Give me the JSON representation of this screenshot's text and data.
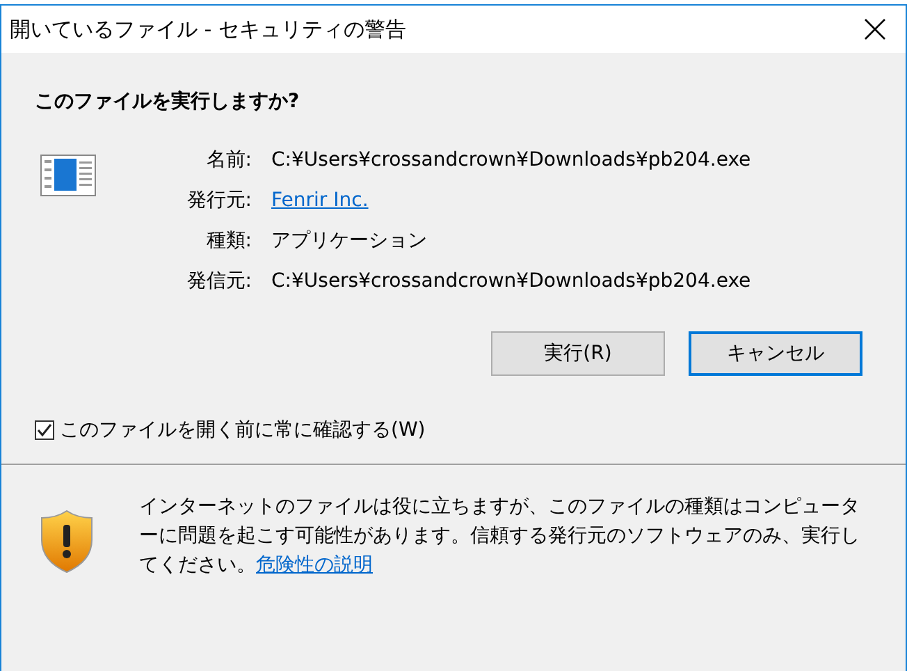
{
  "window": {
    "title": "開いているファイル - セキュリティの警告"
  },
  "heading": "このファイルを実行しますか?",
  "fields": [
    {
      "label": "名前:",
      "value": "C:¥Users¥crossandcrown¥Downloads¥pb204.exe",
      "kind": "text"
    },
    {
      "label": "発行元:",
      "value": "Fenrir Inc.",
      "kind": "link"
    },
    {
      "label": "種類:",
      "value": "アプリケーション",
      "kind": "text"
    },
    {
      "label": "発信元:",
      "value": "C:¥Users¥crossandcrown¥Downloads¥pb204.exe",
      "kind": "text"
    }
  ],
  "buttons": [
    {
      "label": "実行(R)",
      "selected": false
    },
    {
      "label": "キャンセル",
      "selected": true
    }
  ],
  "checkbox": {
    "label": "このファイルを開く前に常に確認する(W)",
    "checked": true
  },
  "warning": {
    "text": "インターネットのファイルは役に立ちますが、このファイルの種類はコンピューターに問題を起こす可能性があります。信頼する発行元のソフトウェアのみ、実行してください。",
    "link": "危険性の説明"
  }
}
